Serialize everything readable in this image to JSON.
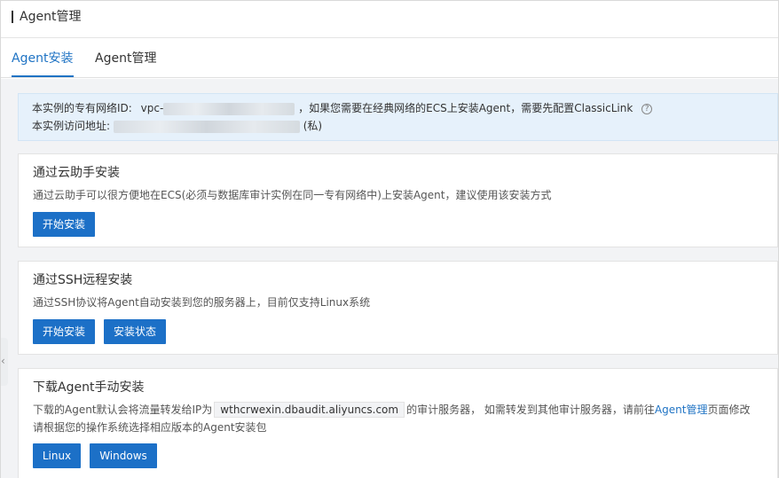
{
  "header": {
    "title": "Agent管理"
  },
  "tabs": [
    {
      "label": "Agent安装",
      "active": true
    },
    {
      "label": "Agent管理",
      "active": false
    }
  ],
  "notice": {
    "vpc_prefix": "本实例的专有网络ID:",
    "vpc_id_visible": "vpc-",
    "vpc_suffix": "，如果您需要在经典网络的ECS上安装Agent，需要先配置ClassicLink",
    "addr_prefix": "本实例访问地址:",
    "addr_suffix": "(私)"
  },
  "cards": {
    "assistant": {
      "title": "通过云助手安装",
      "desc": "通过云助手可以很方便地在ECS(必须与数据库审计实例在同一专有网络中)上安装Agent，建议使用该安装方式",
      "start_label": "开始安装"
    },
    "ssh": {
      "title": "通过SSH远程安装",
      "desc": "通过SSH协议将Agent自动安装到您的服务器上，目前仅支持Linux系统",
      "start_label": "开始安装",
      "status_label": "安装状态"
    },
    "manual": {
      "title": "下载Agent手动安装",
      "desc_part1": "下载的Agent默认会将流量转发给IP为",
      "host": "wthcrwexin.dbaudit.aliyuncs.com",
      "desc_part2": "的审计服务器， 如需转发到其他审计服务器，请前往",
      "link": "Agent管理",
      "desc_part3": "页面修改",
      "desc_line2": "请根据您的操作系统选择相应版本的Agent安装包",
      "linux_label": "Linux",
      "windows_label": "Windows"
    }
  },
  "colors": {
    "accent": "#1c70c7",
    "notice_bg": "#e6f1fb"
  }
}
